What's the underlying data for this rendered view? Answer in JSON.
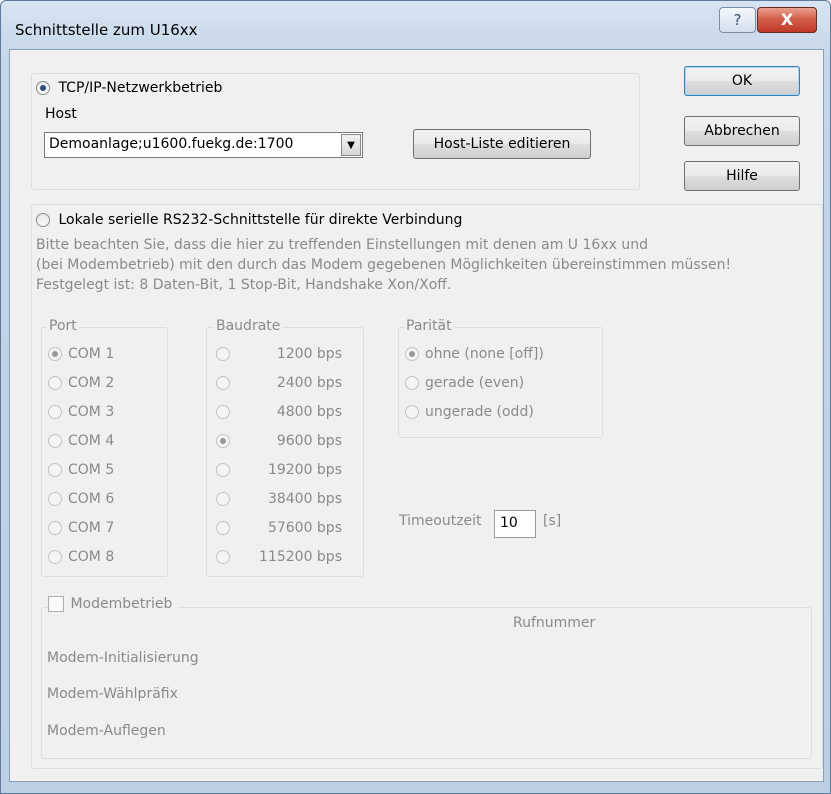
{
  "window": {
    "title": "Schnittstelle zum U16xx",
    "help_glyph": "?",
    "close_glyph": "X"
  },
  "buttons": {
    "ok": "OK",
    "cancel": "Abbrechen",
    "help": "Hilfe"
  },
  "tcp": {
    "radio_label": "TCP/IP-Netzwerkbetrieb",
    "host_label": "Host",
    "host_value": "Demoanlage;u1600.fuekg.de:1700",
    "edit_hosts_button": "Host-Liste editieren"
  },
  "serial": {
    "radio_label": "Lokale serielle RS232-Schnittstelle für direkte Verbindung",
    "info_line1": "Bitte beachten Sie, dass die hier zu treffenden Einstellungen mit denen am U 16xx und",
    "info_line2": "(bei Modembetrieb) mit den durch das Modem gegebenen Möglichkeiten übereinstimmen müssen!",
    "info_line3": "Festgelegt ist: 8 Daten-Bit, 1 Stop-Bit, Handshake Xon/Xoff."
  },
  "port": {
    "title": "Port",
    "options": [
      "COM 1",
      "COM 2",
      "COM 3",
      "COM 4",
      "COM 5",
      "COM 6",
      "COM 7",
      "COM 8"
    ],
    "selected": "COM 1"
  },
  "baud": {
    "title": "Baudrate",
    "options": [
      "1200 bps",
      "2400 bps",
      "4800 bps",
      "9600 bps",
      "19200 bps",
      "38400 bps",
      "57600 bps",
      "115200 bps"
    ],
    "selected": "9600 bps"
  },
  "parity": {
    "title": "Parität",
    "options": [
      "ohne (none [off])",
      "gerade (even)",
      "ungerade (odd)"
    ],
    "selected": "ohne (none [off])"
  },
  "timeout": {
    "label": "Timeoutzeit",
    "value": "10",
    "unit": "[s]"
  },
  "modem": {
    "checkbox_label": "Modembetrieb",
    "phone_label": "Rufnummer",
    "init_label": "Modem-Initialisierung",
    "dial_prefix_label": "Modem-Wählpräfix",
    "hangup_label": "Modem-Auflegen"
  }
}
